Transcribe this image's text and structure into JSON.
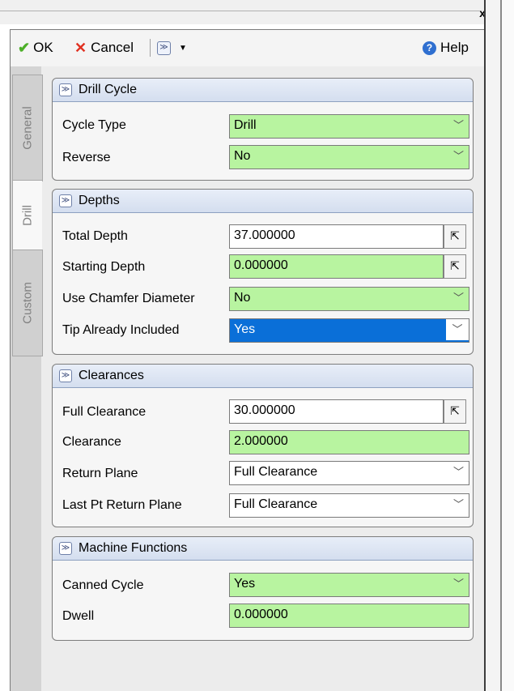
{
  "window": {
    "close_label": "x"
  },
  "toolbar": {
    "ok_label": "OK",
    "cancel_label": "Cancel",
    "help_label": "Help",
    "dropdown_icon": "chevron-down-icon"
  },
  "tabs": [
    {
      "label": "General",
      "active": false
    },
    {
      "label": "Drill",
      "active": true
    },
    {
      "label": "Custom",
      "active": false
    }
  ],
  "groups": {
    "drill_cycle": {
      "title": "Drill Cycle",
      "rows": [
        {
          "label": "Cycle Type",
          "value": "Drill"
        },
        {
          "label": "Reverse",
          "value": "No"
        }
      ]
    },
    "depths": {
      "title": "Depths",
      "rows": [
        {
          "label": "Total Depth",
          "value": "37.000000"
        },
        {
          "label": "Starting Depth",
          "value": "0.000000"
        },
        {
          "label": "Use Chamfer Diameter",
          "value": "No"
        },
        {
          "label": "Tip Already Included",
          "value": "Yes"
        }
      ]
    },
    "clearances": {
      "title": "Clearances",
      "rows": [
        {
          "label": "Full Clearance",
          "value": "30.000000"
        },
        {
          "label": "Clearance",
          "value": "2.000000"
        },
        {
          "label": "Return Plane",
          "value": "Full Clearance"
        },
        {
          "label": "Last Pt Return Plane",
          "value": "Full Clearance"
        }
      ]
    },
    "machine_functions": {
      "title": "Machine Functions",
      "rows": [
        {
          "label": "Canned Cycle",
          "value": "Yes"
        },
        {
          "label": "Dwell",
          "value": "0.000000"
        }
      ]
    }
  },
  "colors": {
    "field_modified": "#b8f4a0",
    "field_selected": "#0a6fd8",
    "group_header": "#d4deef"
  }
}
